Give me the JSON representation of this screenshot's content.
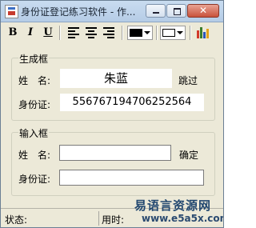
{
  "window": {
    "title": "身份证登记练习软件 - 作...",
    "close_glyph": "✕"
  },
  "toolbar": {
    "bold": "B",
    "italic": "I",
    "underline": "U",
    "font_color": "#000000",
    "border_color": "#ffffff"
  },
  "output_group": {
    "title": "生成框",
    "name_label": "姓　名:",
    "name_value": "朱蓝",
    "skip": "跳过",
    "id_label": "身份证:",
    "id_value": "556767194706252564"
  },
  "input_group": {
    "title": "输入框",
    "name_label": "姓　名:",
    "name_value": "",
    "confirm": "确定",
    "id_label": "身份证:",
    "id_value": ""
  },
  "status": {
    "status_label": "状态:",
    "time_label": "用时:"
  },
  "watermark": {
    "cn": "易语言资源网",
    "url": "www.e5a5x.com"
  }
}
